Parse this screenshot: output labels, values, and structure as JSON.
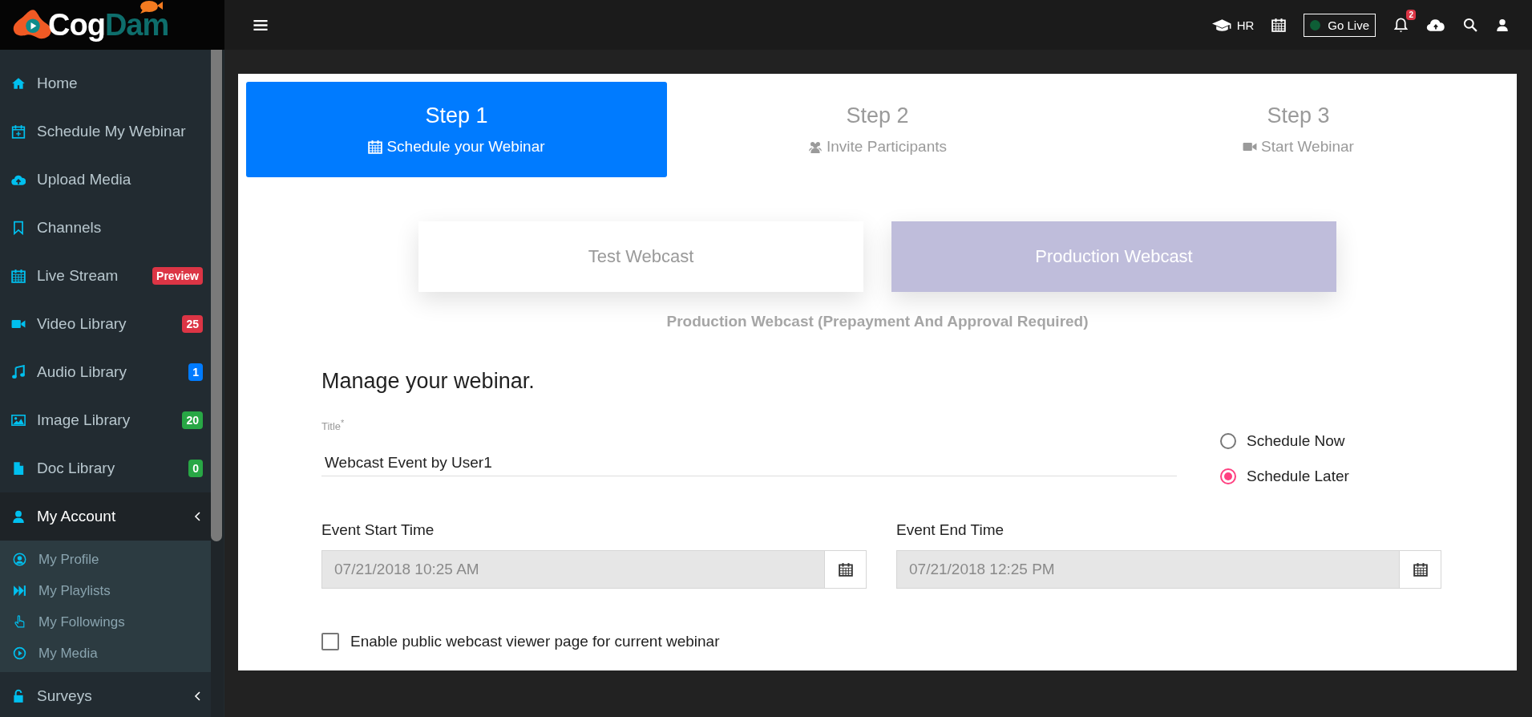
{
  "logo": {
    "part_1": "Cog",
    "part_2": "Dam"
  },
  "topbar": {
    "role": "HR",
    "go_live": "Go Live",
    "notification_count": "2"
  },
  "sidebar": {
    "items": [
      {
        "label": "Home",
        "selected": false
      },
      {
        "label": "Schedule My Webinar",
        "selected": false
      },
      {
        "label": "Upload Media",
        "selected": false
      },
      {
        "label": "Channels",
        "selected": false
      },
      {
        "label": "Live Stream",
        "selected": false,
        "badge": {
          "text": "Preview",
          "color": "#dc3545"
        }
      },
      {
        "label": "Video Library",
        "selected": false,
        "badge": {
          "text": "25",
          "color": "#dc3545"
        }
      },
      {
        "label": "Audio Library",
        "selected": false,
        "badge": {
          "text": "1",
          "color": "#007bff"
        }
      },
      {
        "label": "Image Library",
        "selected": false,
        "badge": {
          "text": "20",
          "color": "#28a745"
        }
      },
      {
        "label": "Doc Library",
        "selected": false,
        "badge": {
          "text": "0",
          "color": "#28a745"
        }
      },
      {
        "label": "My Account",
        "selected": true,
        "submenu": true,
        "children": [
          {
            "label": "My Profile"
          },
          {
            "label": "My Playlists"
          },
          {
            "label": "My Followings"
          },
          {
            "label": "My Media"
          }
        ]
      },
      {
        "label": "Surveys",
        "selected": false,
        "submenu": true
      }
    ]
  },
  "steps": [
    {
      "title": "Step 1",
      "subtitle": "Schedule your Webinar",
      "selected": true
    },
    {
      "title": "Step 2",
      "subtitle": "Invite Participants",
      "selected": false
    },
    {
      "title": "Step 3",
      "subtitle": "Start Webinar",
      "selected": false
    }
  ],
  "webcast_types": [
    {
      "label": "Test Webcast",
      "selected": false
    },
    {
      "label": "Production Webcast",
      "selected": true
    }
  ],
  "webcast_note": "Production Webcast (Prepayment And Approval Required)",
  "form": {
    "heading": "Manage your webinar.",
    "title_field": {
      "label": "Title$^{*}$",
      "value": "Webcast Event by User1"
    },
    "schedule_options": [
      {
        "label": "Schedule Now",
        "selected": false
      },
      {
        "label": "Schedule Later",
        "selected": true
      }
    ],
    "start_time": {
      "label": "Event Start Time",
      "value": "07/21/2018 10:25 AM",
      "disabled": true
    },
    "end_time": {
      "label": "Event End Time",
      "value": "07/21/2018 12:25 PM",
      "disabled": true
    },
    "public_page": {
      "label": "Enable public webcast viewer page for current webinar",
      "checked": false
    }
  }
}
